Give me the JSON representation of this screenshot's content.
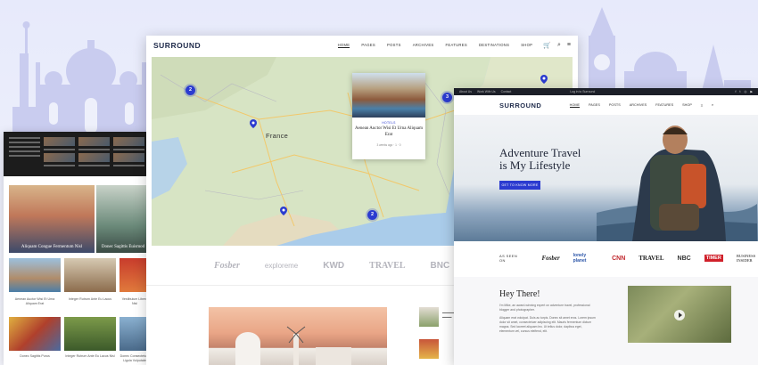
{
  "map_site": {
    "logo": "SURROUND",
    "nav": [
      "HOME",
      "PAGES",
      "POSTS",
      "ARCHIVES",
      "FEATURES",
      "DESTINATIONS",
      "SHOP"
    ],
    "map": {
      "country_label": "France",
      "clusters": [
        "2",
        "2",
        "3"
      ],
      "card": {
        "category": "HOTELS",
        "title": "Aenean Auctor Wisi Et Urna Aliquam Erat",
        "meta": "3 weeks ago · 1 · 0"
      }
    },
    "brands": [
      "Fosber",
      "exploreme",
      "KWD",
      "TRAVEL",
      "BNC"
    ]
  },
  "left_site": {
    "hero_caption": "Aliquam Congue Fermentum Nisl",
    "hero2_caption": "Donec Sagittis Euismod",
    "thumb_captions": [
      "Aenean Auctor Wisi Et Urna Aliquam Erat",
      "Integer Rutrum Ante Eu Lacus",
      "Vestibulum Libero Nisl",
      "Donec Sagittis Purus",
      "Integer Rutrum Ante Eu Lacus Nisl",
      "Donec Consectetuer Ligula Vulputate"
    ]
  },
  "right_site": {
    "topbar_left": [
      "About Us",
      "Work With Us",
      "Contact"
    ],
    "topbar_mid": "Log in to Surround",
    "logo": "SURROUND",
    "nav": [
      "HOME",
      "PAGES",
      "POSTS",
      "ARCHIVES",
      "FEATURES",
      "SHOP"
    ],
    "headline_1": "Adventure Travel",
    "headline_2": "is My Lifestyle",
    "cta": "GET TO KNOW MORE",
    "as_seen_on": "AS SEEN ON",
    "seen_brands": [
      "Fosber",
      "lonely planet",
      "CNN",
      "TRAVEL",
      "NBC",
      "TIMER",
      "BUSINESS INSIDER"
    ],
    "hey_title": "Hey There!",
    "hey_p1": "I'm Mike, an award-winning expert on adventure travel, professional blogger and photographer.",
    "hey_p2": "Aliquam erat volutpat. Duis ac turpis. Donec sit amet eros. Lorem ipsum dolor sit amet, consectetuer adipiscing elit. Mauris fermentum dictum magna. Sed laoreet aliquam leo. Ut tellus dolor, dapibus eget, elementum vel, cursus eleifend, elit."
  }
}
